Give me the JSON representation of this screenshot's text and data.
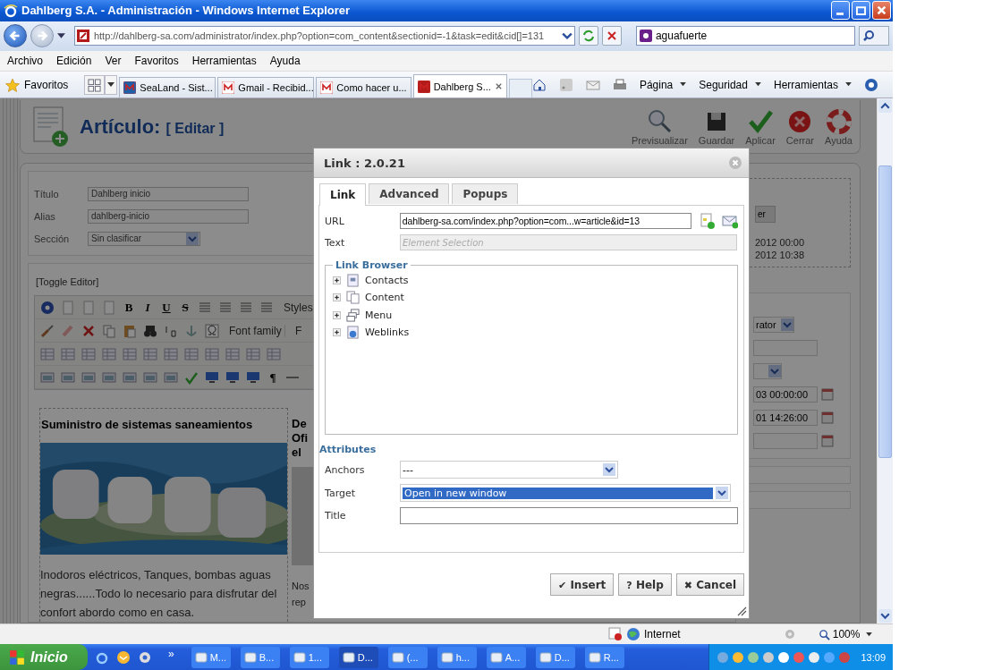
{
  "window": {
    "title": "Dahlberg S.A. - Administración - Windows Internet Explorer"
  },
  "address_bar": {
    "url": "http://dahlberg-sa.com/administrator/index.php?option=com_content&sectionid=-1&task=edit&cid[]=131",
    "search": "aguafuerte"
  },
  "menu": [
    "Archivo",
    "Edición",
    "Ver",
    "Favoritos",
    "Herramientas",
    "Ayuda"
  ],
  "favorites": "Favoritos",
  "tabs": [
    {
      "label": "SeaLand - Sist...",
      "selected": false
    },
    {
      "label": "Gmail - Recibid...",
      "selected": false
    },
    {
      "label": "Como hacer u...",
      "selected": false
    },
    {
      "label": "Dahlberg S...",
      "selected": true
    }
  ],
  "command_bar": [
    "Página",
    "Seguridad",
    "Herramientas"
  ],
  "page": {
    "heading": "Artículo:",
    "heading_sub": "[ Editar ]",
    "toolbar": [
      "Previsualizar",
      "Guardar",
      "Aplicar",
      "Cerrar",
      "Ayuda"
    ],
    "fields": [
      {
        "label": "Título",
        "value": "Dahlberg inicio",
        "kind": "text"
      },
      {
        "label": "Alias",
        "value": "dahlberg-inicio",
        "kind": "text"
      },
      {
        "label": "Sección",
        "value": "Sin clasificar",
        "kind": "select"
      }
    ],
    "toggle_editor": "[Toggle Editor]",
    "format_buttons": [
      "B",
      "I",
      "U",
      "S"
    ],
    "styles": "Styles",
    "font_family": "Font family",
    "font_size": "F",
    "pilcrow": "¶",
    "article": {
      "heading": "Suministro de sistemas saneamientos",
      "body": "Inodoros eléctricos,  Tanques, bombas aguas negras......Todo lo necesario para disfrutar del confort abordo como en casa."
    },
    "column_2_heading": [
      "De",
      "Ofi",
      "el"
    ],
    "column_2_body": [
      "Nos",
      "rep"
    ],
    "side": {
      "button": "er",
      "dates": [
        "2012 00:00",
        "2012 10:38"
      ],
      "author": "rator",
      "date_fields": [
        "03 00:00:00",
        "01 14:26:00"
      ]
    }
  },
  "dialog": {
    "title": "Link : 2.0.21",
    "tabs": [
      {
        "label": "Link",
        "selected": true
      },
      {
        "label": "Advanced",
        "selected": false
      },
      {
        "label": "Popups",
        "selected": false
      }
    ],
    "url_label": "URL",
    "url": "dahlberg-sa.com/index.php?option=com...w=article&id=13",
    "text_label": "Text",
    "text_placeholder": "Element Selection",
    "browser_title": "Link Browser",
    "tree": [
      {
        "label": "Contacts",
        "kind": "contacts",
        "expanded": false
      },
      {
        "label": "Content",
        "kind": "content",
        "expanded": false
      },
      {
        "label": "Menu",
        "kind": "menu",
        "expanded": false
      },
      {
        "label": "Weblinks",
        "kind": "weblinks",
        "expanded": false
      }
    ],
    "attributes_title": "Attributes",
    "anchors_label": "Anchors",
    "anchors_value": "---",
    "target_label": "Target",
    "target_value": "Open in new window",
    "title_label": "Title",
    "buttons": [
      {
        "label": "Insert",
        "icon": "✔"
      },
      {
        "label": "Help",
        "icon": "?"
      },
      {
        "label": "Cancel",
        "icon": "✖"
      }
    ]
  },
  "status_bar": {
    "zone": "Internet",
    "zoom": "100%"
  },
  "taskbar": {
    "start": "Inicio",
    "chevron": "»",
    "items": [
      {
        "label": "M...",
        "selected": false
      },
      {
        "label": "B...",
        "selected": false
      },
      {
        "label": "1...",
        "selected": false
      },
      {
        "label": "D...",
        "selected": true
      },
      {
        "label": "(...",
        "selected": false
      },
      {
        "label": "h...",
        "selected": false
      },
      {
        "label": "A...",
        "selected": false
      },
      {
        "label": "D...",
        "selected": false
      },
      {
        "label": "R...",
        "selected": false
      }
    ],
    "clock": "13:09"
  }
}
